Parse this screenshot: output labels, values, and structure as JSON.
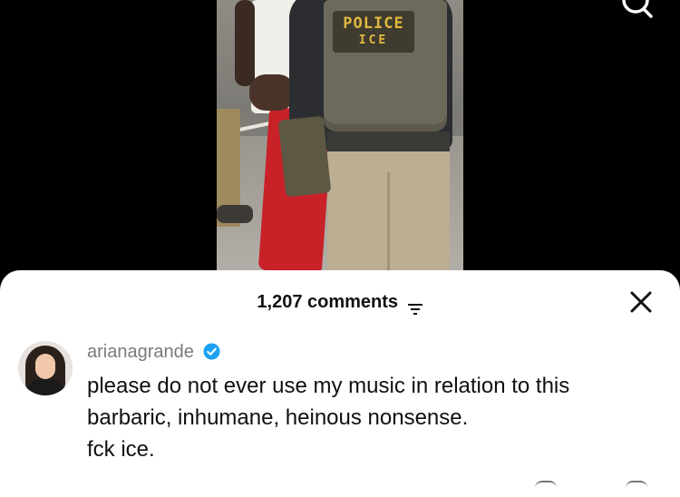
{
  "header": {
    "icons": [
      "search-icon"
    ]
  },
  "video": {
    "vest_patch_line1": "POLICE",
    "vest_patch_line2": "ICE"
  },
  "comments_sheet": {
    "count_label": "1,207 comments",
    "icons": [
      "filter-icon",
      "close-icon"
    ]
  },
  "comment": {
    "username": "arianagrande",
    "verified": true,
    "text_lines": [
      "please do not ever use my music in relation to this",
      "barbaric, inhumane, heinous nonsense.",
      "fck ice."
    ]
  },
  "colors": {
    "accent_verified": "#1da1f2",
    "sheet_bg": "#ffffff",
    "background": "#000000"
  }
}
